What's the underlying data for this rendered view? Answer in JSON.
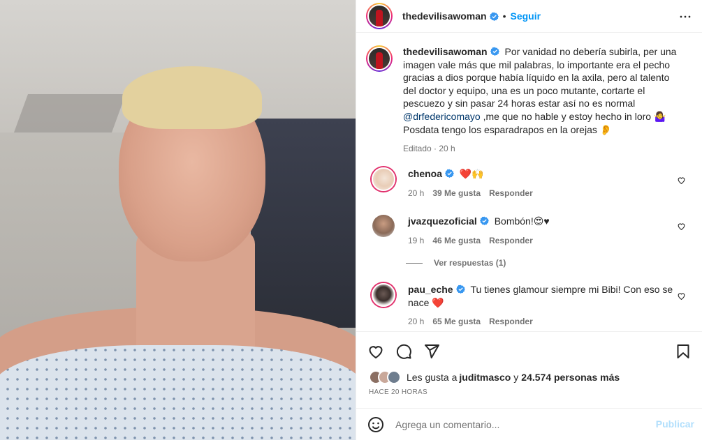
{
  "post": {
    "username": "thedevilisawoman",
    "follow_label": "Seguir",
    "separator": "•",
    "caption_parts": {
      "p1": "Por vanidad no debería subirla, per una imagen vale más que mil palabras, lo importante era el pecho gracias a dios porque había líquido en la axila, pero al talento del doctor y equipo, una es un poco mutante, cortarte el pescuezo y sin pasar 24 horas estar así no es normal ",
      "mention": "@drfedericomayo",
      "p2": " ,me que no hable y estoy hecho in loro 🤷‍♀️ Posdata tengo los esparadrapos en la orejas 👂"
    },
    "caption_meta": "Editado · 20 h"
  },
  "comments": [
    {
      "username": "chenoa",
      "text": "❤️🙌",
      "time": "20 h",
      "likes": "39 Me gusta",
      "reply": "Responder"
    },
    {
      "username": "jvazquezoficial",
      "text": "Bombón!😍♥",
      "time": "19 h",
      "likes": "46 Me gusta",
      "reply": "Responder"
    },
    {
      "username": "pau_eche",
      "text": "Tu tienes glamour siempre mi Bibi! Con eso se nace ❤️",
      "time": "20 h",
      "likes": "65 Me gusta",
      "reply": "Responder"
    }
  ],
  "view_replies": "Ver respuestas (1)",
  "likes_line": {
    "prefix": "Les gusta a ",
    "user": "juditmasco",
    "middle": " y ",
    "count": "24.574 personas más"
  },
  "timestamp": "HACE 20 HORAS",
  "add_comment": {
    "placeholder": "Agrega un comentario...",
    "publish": "Publicar"
  },
  "colors": {
    "accent": "#0095f6",
    "verified": "#3897f0",
    "text": "#262626",
    "muted": "#737373",
    "heart": "#ed4956"
  },
  "icons": [
    "more-options-icon",
    "verified-icon",
    "heart-icon",
    "comment-icon",
    "share-icon",
    "bookmark-icon",
    "emoji-icon"
  ]
}
